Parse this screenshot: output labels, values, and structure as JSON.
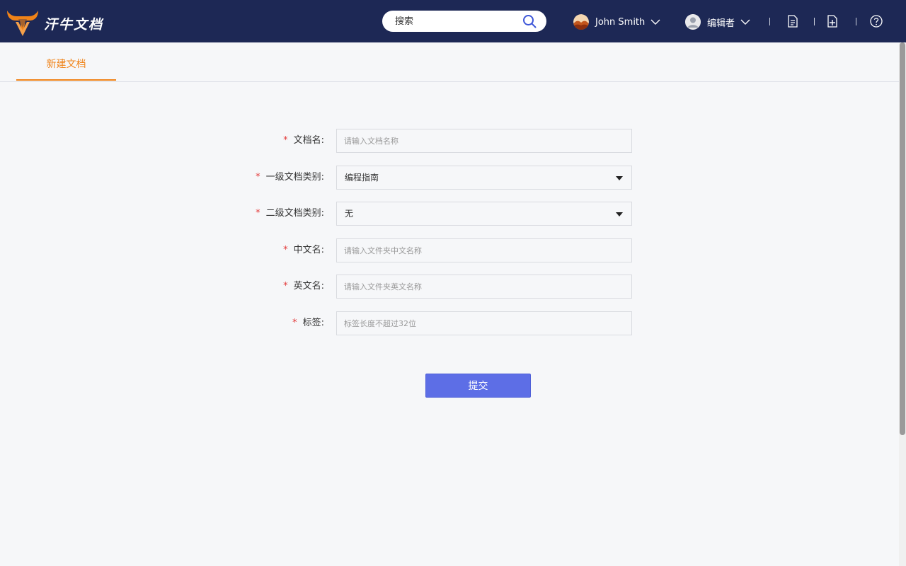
{
  "header": {
    "brand": "汗牛文档",
    "search": {
      "placeholder": "搜索",
      "value": ""
    },
    "user": {
      "name": "John Smith"
    },
    "role": {
      "label": "编辑者"
    },
    "colors": {
      "bar": "#1d2855",
      "accent": "#f08318",
      "primary": "#5d6ee6"
    }
  },
  "tabs": [
    {
      "label": "新建文档",
      "active": true
    }
  ],
  "form": {
    "fields": [
      {
        "label": "文档名:",
        "required": true,
        "type": "input",
        "value": "",
        "placeholder": "请输入文档名称"
      },
      {
        "label": "一级文档类别:",
        "required": true,
        "type": "select",
        "value": "编程指南"
      },
      {
        "label": "二级文档类别:",
        "required": true,
        "type": "select",
        "value": "无"
      },
      {
        "label": "中文名:",
        "required": true,
        "type": "input",
        "value": "",
        "placeholder": "请输入文件夹中文名称"
      },
      {
        "label": "英文名:",
        "required": true,
        "type": "input",
        "value": "",
        "placeholder": "请输入文件夹英文名称"
      },
      {
        "label": "标签:",
        "required": true,
        "type": "input",
        "value": "",
        "placeholder": "标签长度不超过32位"
      }
    ],
    "required_mark": "*",
    "submit_label": "提交"
  }
}
